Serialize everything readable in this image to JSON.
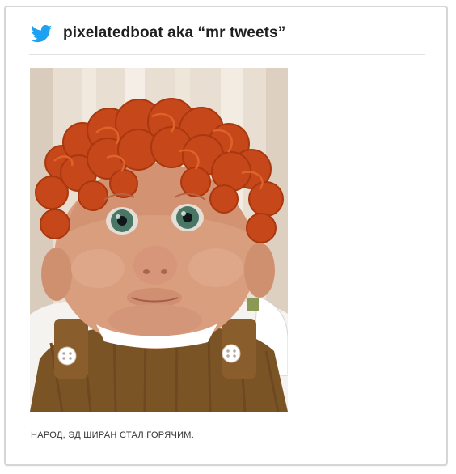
{
  "post": {
    "icon": "twitter-bird-icon",
    "username": "pixelatedboat aka “mr tweets”",
    "caption": "НАРОД, ЭД ШИРАН СТАЛ ГОРЯЧИМ."
  },
  "colors": {
    "twitter_blue": "#1DA1F2",
    "text": "#1f1f1f",
    "border": "#d6d6d6"
  }
}
